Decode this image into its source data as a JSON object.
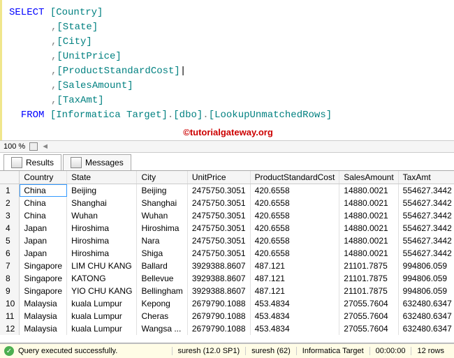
{
  "sql": {
    "select": "SELECT",
    "from": "FROM",
    "cols": [
      "[Country]",
      "[State]",
      "[City]",
      "[UnitPrice]",
      "[ProductStandardCost]",
      "[SalesAmount]",
      "[TaxAmt]"
    ],
    "from_parts": [
      "[Informatica Target]",
      "[dbo]",
      "[LookupUnmatchedRows]"
    ],
    "comma": ",",
    "dot": "."
  },
  "zoom": "100 %",
  "watermark": "©tutorialgateway.org",
  "tabs": {
    "results": "Results",
    "messages": "Messages"
  },
  "grid": {
    "headers": [
      "Country",
      "State",
      "City",
      "UnitPrice",
      "ProductStandardCost",
      "SalesAmount",
      "TaxAmt"
    ],
    "rows": [
      [
        "China",
        "Beijing",
        "Beijing",
        "2475750.3051",
        "420.6558",
        "14880.0021",
        "554627.3442"
      ],
      [
        "China",
        "Shanghai",
        "Shanghai",
        "2475750.3051",
        "420.6558",
        "14880.0021",
        "554627.3442"
      ],
      [
        "China",
        "Wuhan",
        "Wuhan",
        "2475750.3051",
        "420.6558",
        "14880.0021",
        "554627.3442"
      ],
      [
        "Japan",
        "Hiroshima",
        "Hiroshima",
        "2475750.3051",
        "420.6558",
        "14880.0021",
        "554627.3442"
      ],
      [
        "Japan",
        "Hiroshima",
        "Nara",
        "2475750.3051",
        "420.6558",
        "14880.0021",
        "554627.3442"
      ],
      [
        "Japan",
        "Hiroshima",
        "Shiga",
        "2475750.3051",
        "420.6558",
        "14880.0021",
        "554627.3442"
      ],
      [
        "Singapore",
        "LIM CHU KANG",
        "Ballard",
        "3929388.8607",
        "487.121",
        "21101.7875",
        "994806.059"
      ],
      [
        "Singapore",
        "KATONG",
        "Bellevue",
        "3929388.8607",
        "487.121",
        "21101.7875",
        "994806.059"
      ],
      [
        "Singapore",
        "YIO CHU KANG",
        "Bellingham",
        "3929388.8607",
        "487.121",
        "21101.7875",
        "994806.059"
      ],
      [
        "Malaysia",
        "kuala Lumpur",
        "Kepong",
        "2679790.1088",
        "453.4834",
        "27055.7604",
        "632480.6347"
      ],
      [
        "Malaysia",
        "kuala Lumpur",
        "Cheras",
        "2679790.1088",
        "453.4834",
        "27055.7604",
        "632480.6347"
      ],
      [
        "Malaysia",
        "kuala Lumpur",
        "Wangsa ...",
        "2679790.1088",
        "453.4834",
        "27055.7604",
        "632480.6347"
      ]
    ]
  },
  "status": {
    "msg": "Query executed successfully.",
    "server": "suresh (12.0 SP1)",
    "login": "suresh (62)",
    "db": "Informatica Target",
    "time": "00:00:00",
    "rows": "12 rows"
  }
}
